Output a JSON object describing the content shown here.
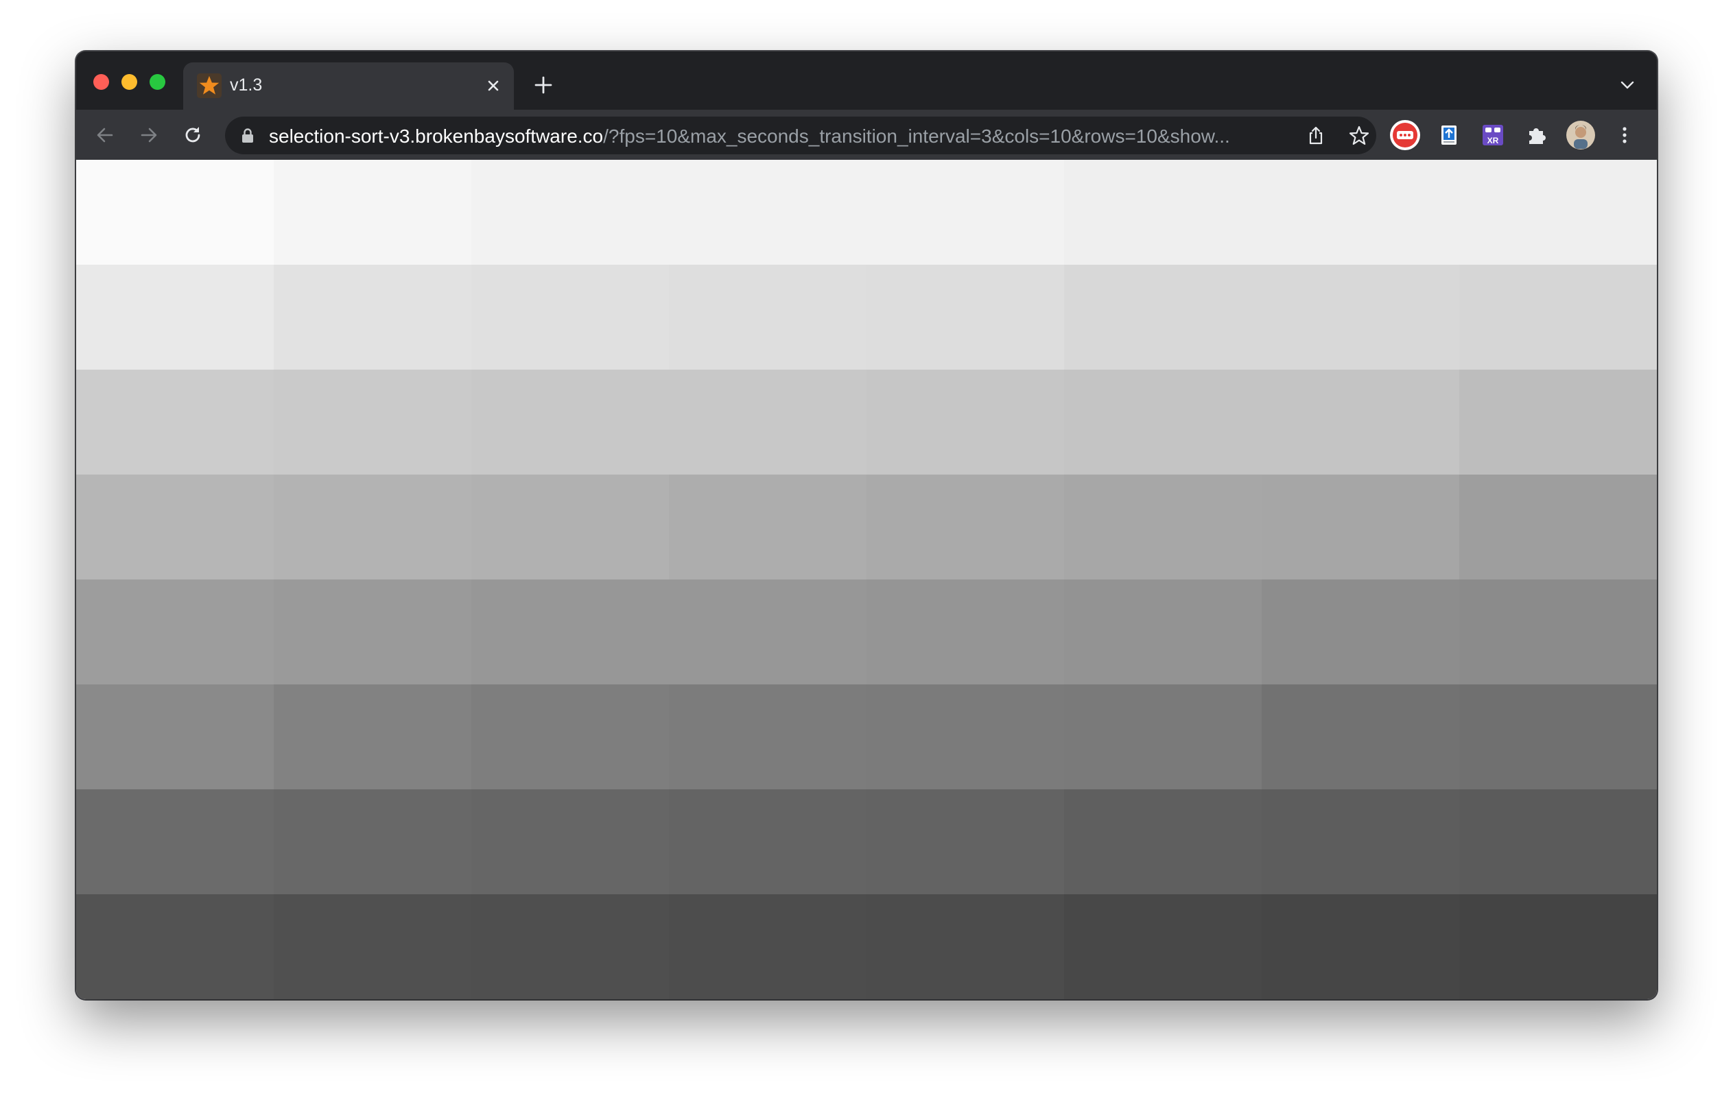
{
  "browser": {
    "window_controls": {
      "close_color": "#ff5f57",
      "minimize_color": "#febc2e",
      "maximize_color": "#28c840"
    },
    "tab": {
      "title": "v1.3",
      "favicon": "orange-star-icon",
      "favicon_color": "#f08c1e"
    },
    "address_bar": {
      "host": "selection-sort-v3.brokenbaysoftware.co",
      "rest": "/?fps=10&max_seconds_transition_interval=3&cols=10&rows=10&show..."
    },
    "toolbar_icons": [
      "back-icon",
      "forward-icon",
      "reload-icon",
      "lock-icon",
      "share-icon",
      "bookmark-star-icon"
    ],
    "extensions": [
      "red-chat-extension-icon",
      "upload-extension-icon",
      "xr-extension-icon",
      "puzzle-extensions-icon",
      "profile-avatar",
      "more-menu-icon"
    ],
    "extension_colors": {
      "red_chat": "#e53935",
      "xr": "#6a4bc4"
    }
  },
  "page": {
    "grid": {
      "visible_cols": 8,
      "visible_rows": 8,
      "colors": [
        [
          "#fafafa",
          "#f5f5f5",
          "#f2f2f2",
          "#f2f2f2",
          "#f2f2f2",
          "#efefef",
          "#efefef",
          "#efefef"
        ],
        [
          "#e9e9e9",
          "#e2e2e2",
          "#e0e0e0",
          "#dedede",
          "#dddddd",
          "#d8d8d8",
          "#d8d8d8",
          "#d6d6d6"
        ],
        [
          "#cccccc",
          "#cacaca",
          "#c8c8c8",
          "#c8c8c8",
          "#c6c6c6",
          "#c4c4c4",
          "#c4c4c4",
          "#bdbdbd"
        ],
        [
          "#b6b6b6",
          "#b3b3b3",
          "#b1b1b1",
          "#adadad",
          "#aaaaaa",
          "#a7a7a7",
          "#a6a6a6",
          "#9e9e9e"
        ],
        [
          "#9d9d9d",
          "#9a9a9a",
          "#979797",
          "#979797",
          "#959595",
          "#939393",
          "#8d8d8d",
          "#8b8b8b"
        ],
        [
          "#8a8a8a",
          "#828282",
          "#7e7e7e",
          "#7c7c7c",
          "#7b7b7b",
          "#7a7a7a",
          "#727272",
          "#707070"
        ],
        [
          "#6b6b6b",
          "#686868",
          "#666666",
          "#646464",
          "#636363",
          "#5f5f5f",
          "#5d5d5d",
          "#5b5b5b"
        ],
        [
          "#535353",
          "#505050",
          "#4f4f4f",
          "#4d4d4d",
          "#4c4c4c",
          "#484848",
          "#464646",
          "#444444"
        ]
      ]
    }
  }
}
